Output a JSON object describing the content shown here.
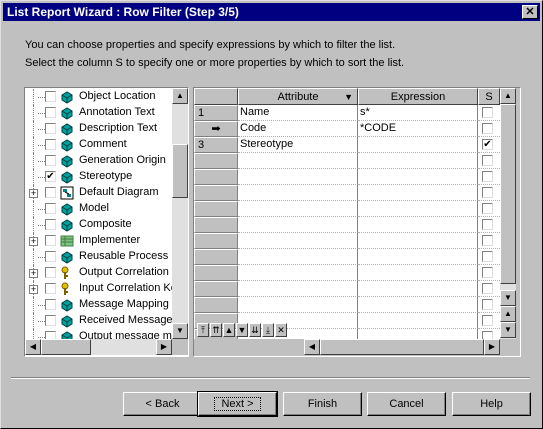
{
  "window": {
    "title": "List Report Wizard : Row Filter (Step 3/5)",
    "close_glyph": "✕"
  },
  "description": {
    "line1": "You can choose properties and specify expressions by which to filter the list.",
    "line2": "Select the column S to specify one or more properties by which to sort the list."
  },
  "tree": {
    "items": [
      {
        "label": "Object Location",
        "checked": false,
        "expander": false,
        "icon": "object-icon"
      },
      {
        "label": "Annotation Text",
        "checked": false,
        "expander": false,
        "icon": "object-icon"
      },
      {
        "label": "Description Text",
        "checked": false,
        "expander": false,
        "icon": "object-icon"
      },
      {
        "label": "Comment",
        "checked": false,
        "expander": false,
        "icon": "object-icon"
      },
      {
        "label": "Generation Origin",
        "checked": false,
        "expander": false,
        "icon": "object-icon"
      },
      {
        "label": "Stereotype",
        "checked": true,
        "expander": false,
        "icon": "object-icon"
      },
      {
        "label": "Default Diagram",
        "checked": false,
        "expander": true,
        "icon": "diagram-icon"
      },
      {
        "label": "Model",
        "checked": false,
        "expander": false,
        "icon": "object-icon"
      },
      {
        "label": "Composite",
        "checked": false,
        "expander": false,
        "icon": "object-icon"
      },
      {
        "label": "Implementer",
        "checked": false,
        "expander": true,
        "icon": "grid-icon"
      },
      {
        "label": "Reusable Process",
        "checked": false,
        "expander": false,
        "icon": "object-icon"
      },
      {
        "label": "Output Correlation K",
        "checked": false,
        "expander": true,
        "icon": "key-icon"
      },
      {
        "label": "Input Correlation Ke",
        "checked": false,
        "expander": true,
        "icon": "key-icon"
      },
      {
        "label": "Message Mapping",
        "checked": false,
        "expander": false,
        "icon": "object-icon"
      },
      {
        "label": "Received Message",
        "checked": false,
        "expander": false,
        "icon": "object-icon"
      },
      {
        "label": "Output message ma",
        "checked": false,
        "expander": false,
        "icon": "object-icon"
      }
    ]
  },
  "grid": {
    "columns": {
      "attribute": "Attribute",
      "expression": "Expression",
      "sort": "S"
    },
    "rows": [
      {
        "marker": "1",
        "attribute": "Name",
        "expression": "s*",
        "sort": false
      },
      {
        "marker": "➡",
        "attribute": "Code",
        "expression": "*CODE",
        "sort": false
      },
      {
        "marker": "3",
        "attribute": "Stereotype",
        "expression": "",
        "sort": true
      }
    ],
    "empty_rows": 12,
    "nav_buttons": [
      "⤒",
      "⇈",
      "▲",
      "▼",
      "⇊",
      "⤓",
      "✕"
    ]
  },
  "buttons": {
    "back": "< Back",
    "next": "Next >",
    "finish": "Finish",
    "cancel": "Cancel",
    "help": "Help"
  },
  "icons": {
    "scroll_up": "▲",
    "scroll_down": "▼",
    "scroll_left": "◀",
    "scroll_right": "▶",
    "dropdown": "▼"
  },
  "colors": {
    "titlebar": "#000080",
    "face": "#c0c0c0",
    "object_icon": "#00a0a0"
  }
}
